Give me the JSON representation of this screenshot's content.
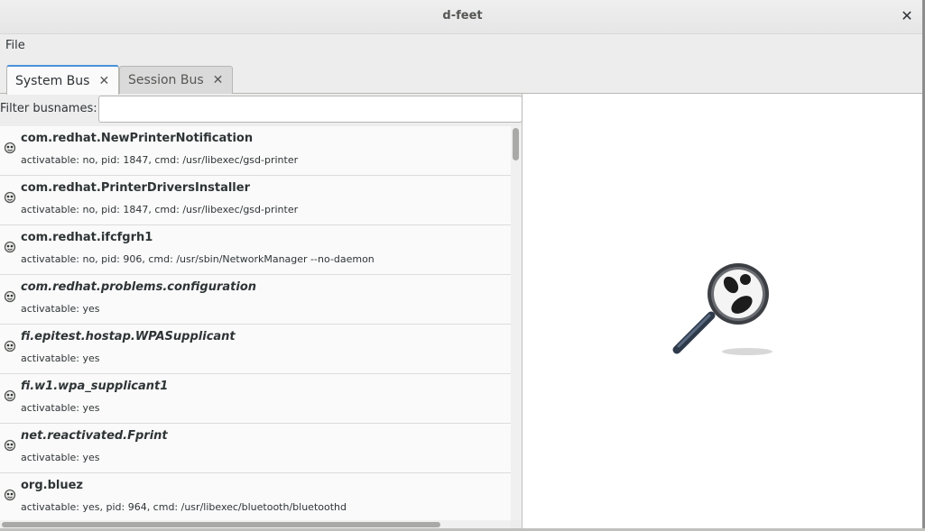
{
  "window": {
    "title": "d-feet"
  },
  "menubar": {
    "file_label": "File"
  },
  "tabs": [
    {
      "label": "System Bus",
      "active": true
    },
    {
      "label": "Session Bus",
      "active": false
    }
  ],
  "filter": {
    "label": "Filter busnames:",
    "value": "",
    "placeholder": ""
  },
  "bus_list": [
    {
      "name": "com.redhat.NewPrinterNotification",
      "info": "activatable: no, pid: 1847, cmd: /usr/libexec/gsd-printer",
      "italic": false
    },
    {
      "name": "com.redhat.PrinterDriversInstaller",
      "info": "activatable: no, pid: 1847, cmd: /usr/libexec/gsd-printer",
      "italic": false
    },
    {
      "name": "com.redhat.ifcfgrh1",
      "info": "activatable: no, pid: 906, cmd: /usr/sbin/NetworkManager --no-daemon",
      "italic": false
    },
    {
      "name": "com.redhat.problems.configuration",
      "info": "activatable: yes",
      "italic": true
    },
    {
      "name": "fi.epitest.hostap.WPASupplicant",
      "info": "activatable: yes",
      "italic": true
    },
    {
      "name": "fi.w1.wpa_supplicant1",
      "info": "activatable: yes",
      "italic": true
    },
    {
      "name": "net.reactivated.Fprint",
      "info": "activatable: yes",
      "italic": true
    },
    {
      "name": "org.bluez",
      "info": "activatable: yes, pid: 964, cmd: /usr/libexec/bluetooth/bluetoothd",
      "italic": false
    }
  ],
  "icons": {
    "close": "close-icon",
    "tab_close": "close-icon",
    "bus_item": "bus-icon",
    "placeholder": "magnifier-icon"
  },
  "colors": {
    "accent": "#4a90d9"
  }
}
